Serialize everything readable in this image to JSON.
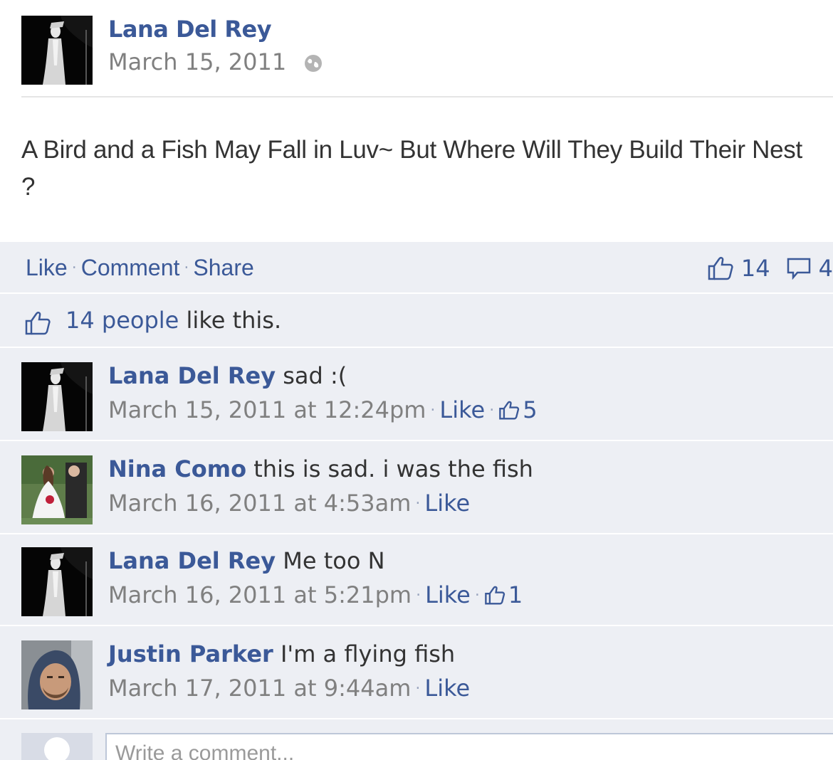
{
  "post": {
    "author": "Lana Del Rey",
    "date": "March 15, 2011",
    "text": "A Bird and a Fish May Fall in Luv~ But Where Will They Build Their Nest ?"
  },
  "actions": {
    "like": "Like",
    "comment": "Comment",
    "share": "Share",
    "like_count": "14",
    "comment_count": "4"
  },
  "likes_summary": {
    "people": "14 people",
    "suffix": " like this."
  },
  "comments": [
    {
      "author": "Lana Del Rey",
      "text": " sad :(",
      "timestamp": "March 15, 2011 at 12:24pm",
      "like_label": "Like",
      "likes": "5"
    },
    {
      "author": "Nina Como",
      "text": " this is sad. i was the fish",
      "timestamp": "March 16, 2011 at 4:53am",
      "like_label": "Like"
    },
    {
      "author": "Lana Del Rey",
      "text": " Me too N",
      "timestamp": "March 16, 2011 at 5:21pm",
      "like_label": "Like",
      "likes": "1"
    },
    {
      "author": "Justin Parker",
      "text": " I'm a flying fish",
      "timestamp": "March 17, 2011 at 9:44am",
      "like_label": "Like"
    }
  ],
  "composer": {
    "placeholder": "Write a comment..."
  },
  "colors": {
    "link": "#3b5998",
    "ufi_background": "#edeff4"
  }
}
